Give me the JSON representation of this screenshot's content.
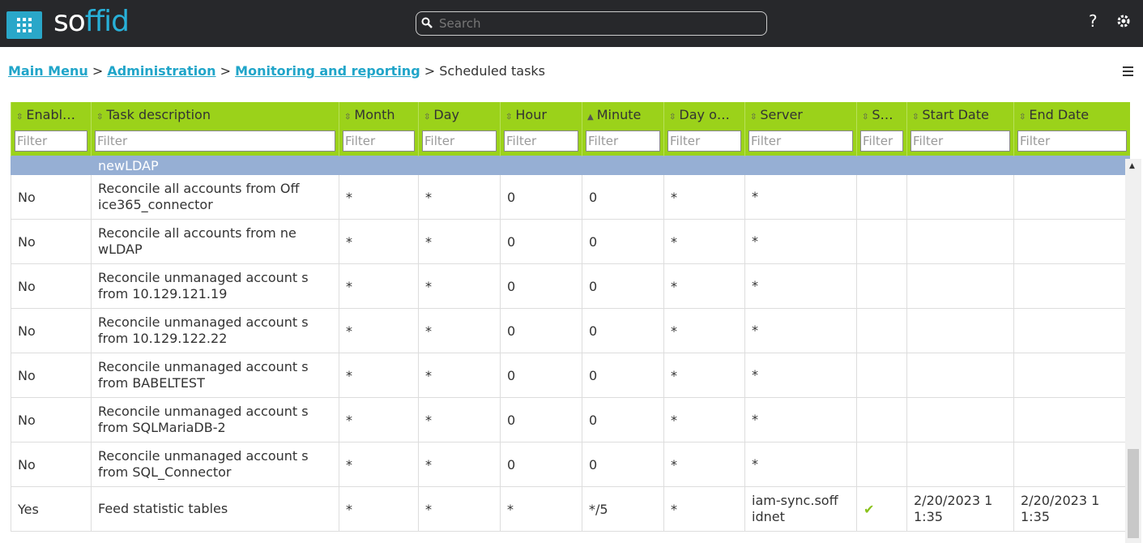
{
  "header": {
    "logo_text_a": "so",
    "logo_text_b": "f",
    "logo_text_c": "fid",
    "search_placeholder": "Search",
    "help_label": "?"
  },
  "breadcrumb": {
    "main_menu": "Main Menu",
    "administration": "Administration",
    "monitoring": "Monitoring and reporting",
    "current": "Scheduled tasks",
    "sep": ">"
  },
  "table": {
    "columns": [
      "Enabl…",
      "Task description",
      "Month",
      "Day",
      "Hour",
      "Minute",
      "Day o…",
      "Server",
      "S…",
      "Start Date",
      "End Date"
    ],
    "filter_placeholder": "Filter",
    "selected_row_text": "newLDAP",
    "rows": [
      {
        "enabled": "No",
        "desc": "Reconcile all accounts from Off ice365_connector",
        "month": "*",
        "day": "*",
        "hour": "0",
        "minute": "0",
        "dow": "*",
        "server": "*",
        "status": "",
        "start": "",
        "end": ""
      },
      {
        "enabled": "No",
        "desc": "Reconcile all accounts from ne wLDAP",
        "month": "*",
        "day": "*",
        "hour": "0",
        "minute": "0",
        "dow": "*",
        "server": "*",
        "status": "",
        "start": "",
        "end": ""
      },
      {
        "enabled": "No",
        "desc": "Reconcile unmanaged account s from 10.129.121.19",
        "month": "*",
        "day": "*",
        "hour": "0",
        "minute": "0",
        "dow": "*",
        "server": "*",
        "status": "",
        "start": "",
        "end": ""
      },
      {
        "enabled": "No",
        "desc": "Reconcile unmanaged account s from 10.129.122.22",
        "month": "*",
        "day": "*",
        "hour": "0",
        "minute": "0",
        "dow": "*",
        "server": "*",
        "status": "",
        "start": "",
        "end": ""
      },
      {
        "enabled": "No",
        "desc": "Reconcile unmanaged account s from BABELTEST",
        "month": "*",
        "day": "*",
        "hour": "0",
        "minute": "0",
        "dow": "*",
        "server": "*",
        "status": "",
        "start": "",
        "end": ""
      },
      {
        "enabled": "No",
        "desc": "Reconcile unmanaged account s from SQLMariaDB-2",
        "month": "*",
        "day": "*",
        "hour": "0",
        "minute": "0",
        "dow": "*",
        "server": "*",
        "status": "",
        "start": "",
        "end": ""
      },
      {
        "enabled": "No",
        "desc": "Reconcile unmanaged account s from SQL_Connector",
        "month": "*",
        "day": "*",
        "hour": "0",
        "minute": "0",
        "dow": "*",
        "server": "*",
        "status": "",
        "start": "",
        "end": ""
      },
      {
        "enabled": "Yes",
        "desc": "Feed statistic tables",
        "month": "*",
        "day": "*",
        "hour": "*",
        "minute": "*/5",
        "dow": "*",
        "server": "iam-sync.soff idnet",
        "status": "✔",
        "start": "2/20/2023 1 1:35",
        "end": "2/20/2023 1 1:35"
      }
    ]
  },
  "colors": {
    "topbar": "#27282b",
    "accent": "#2aa7c9",
    "header_green": "#9bd21a",
    "selected_row": "#96afd4"
  }
}
